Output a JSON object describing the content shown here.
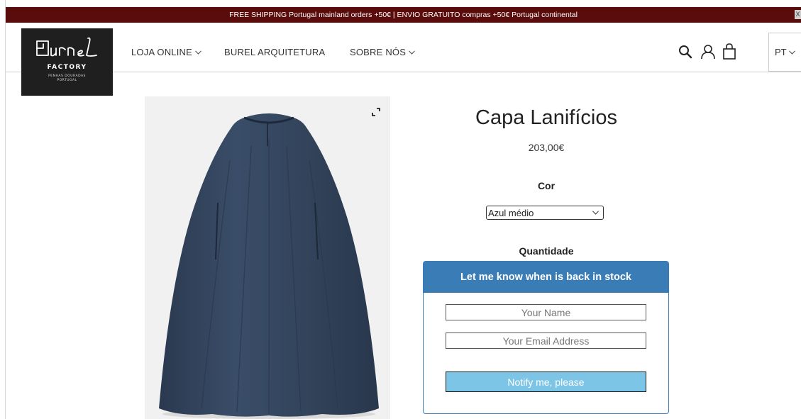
{
  "announcement": {
    "text": "FREE SHIPPING Portugal mainland orders +50€ | ENVIO GRATUITO compras +50€ Portugal continental",
    "close": "X"
  },
  "logo": {
    "wordmark": "Burel",
    "subtitle": "FACTORY",
    "tagline_1": "PENHAS DOURADAS",
    "tagline_2": "PORTUGAL"
  },
  "nav": {
    "items": [
      {
        "label": "LOJA ONLINE",
        "has_dropdown": true
      },
      {
        "label": "BUREL ARQUITETURA",
        "has_dropdown": false
      },
      {
        "label": "SOBRE NÓS",
        "has_dropdown": true
      }
    ]
  },
  "header_icons": [
    "search-icon",
    "account-icon",
    "cart-icon"
  ],
  "language": {
    "selected": "PT"
  },
  "product": {
    "title": "Capa Lanifícios",
    "price": "203,00€",
    "color_label": "Cor",
    "color_selected": "Azul médio",
    "quantity_label": "Quantidade",
    "image_subject": "navy-wool-cape"
  },
  "stock_notify": {
    "heading": "Let me know when is back in stock",
    "name_placeholder": "Your Name",
    "email_placeholder": "Your Email Address",
    "button_label": "Notify me, please"
  },
  "colors": {
    "announcement_bg": "#5a0b0b",
    "logo_bg": "#1f1f1f",
    "notify_header": "#3a7cb5",
    "notify_button": "#7dc5e6",
    "cape": "#34465e"
  }
}
